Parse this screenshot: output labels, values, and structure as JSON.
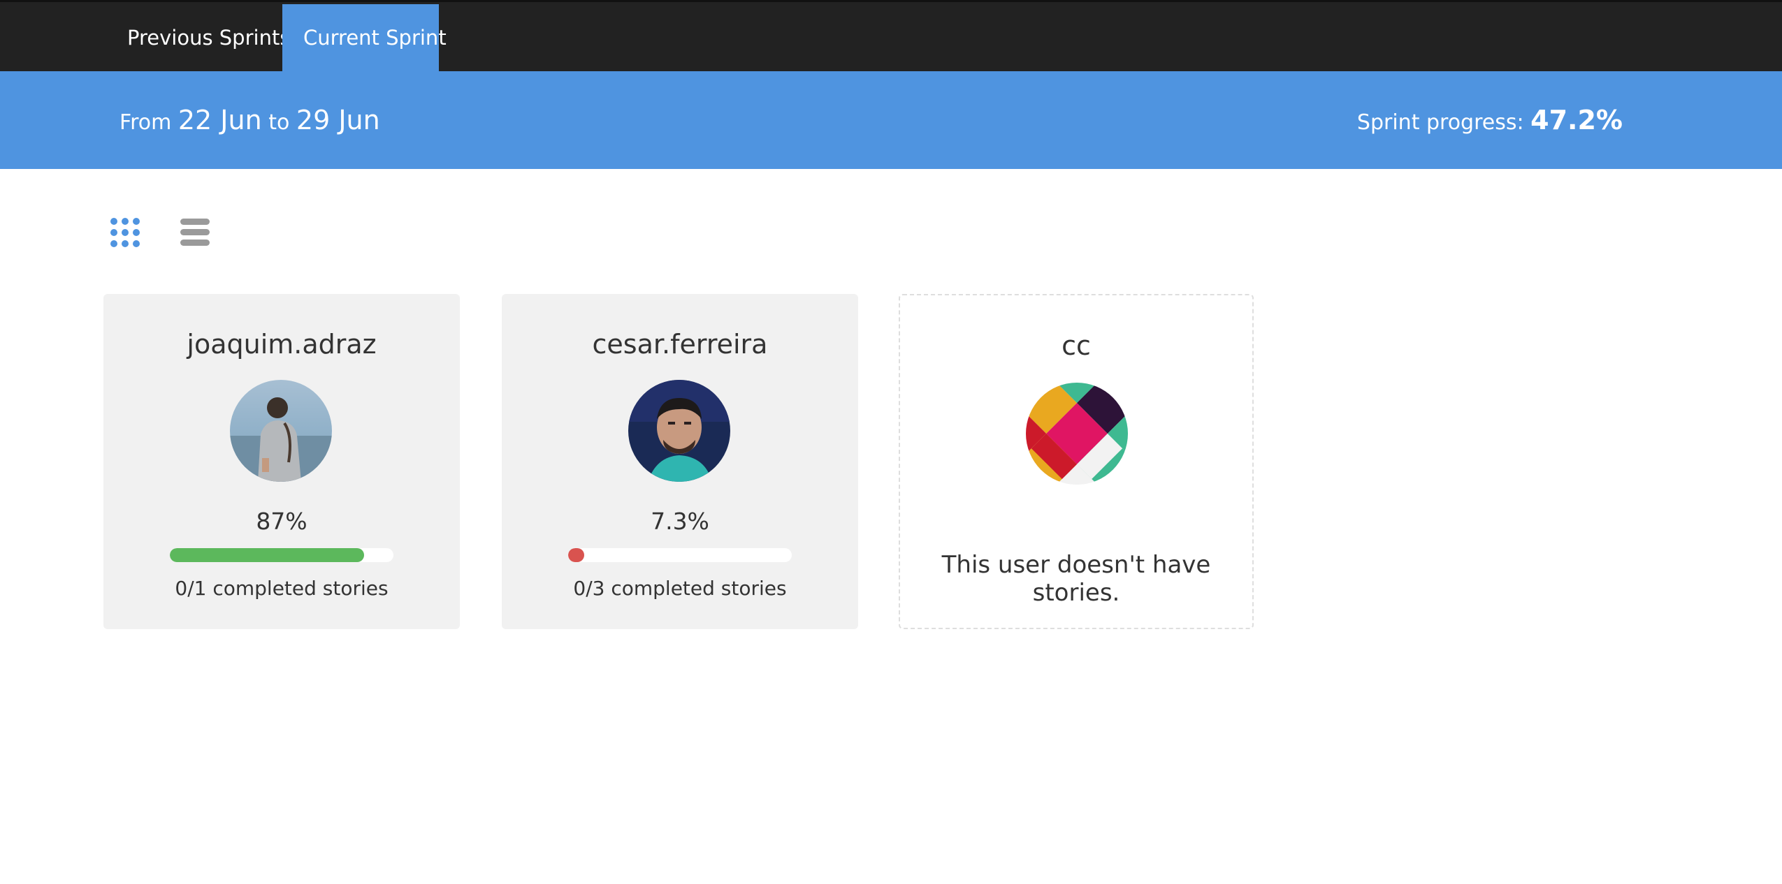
{
  "nav": {
    "tabs": [
      {
        "label": "Previous Sprints",
        "active": false
      },
      {
        "label": "Current Sprint",
        "active": true
      }
    ]
  },
  "sprint": {
    "from_word": "From",
    "from_date": "22 Jun",
    "to_word": "to",
    "to_date": "29 Jun",
    "progress_label": "Sprint progress:",
    "progress_value": "47.2%"
  },
  "view_toggles": {
    "grid_icon": "grid-icon",
    "list_icon": "list-icon",
    "active": "grid"
  },
  "users": [
    {
      "name": "joaquim.adraz",
      "percent_label": "87%",
      "progress": 0.87,
      "bar_color": "#5cb85c",
      "stories": "0/1 completed stories"
    },
    {
      "name": "cesar.ferreira",
      "percent_label": "7.3%",
      "progress": 0.073,
      "bar_color": "#d9534f",
      "stories": "0/3 completed stories"
    },
    {
      "name": "cc",
      "no_stories": "This user doesn't have stories."
    }
  ],
  "colors": {
    "nav_bg": "#222222",
    "accent": "#4f94e0",
    "card_bg": "#f1f1f1",
    "success": "#5cb85c",
    "danger": "#d9534f"
  }
}
